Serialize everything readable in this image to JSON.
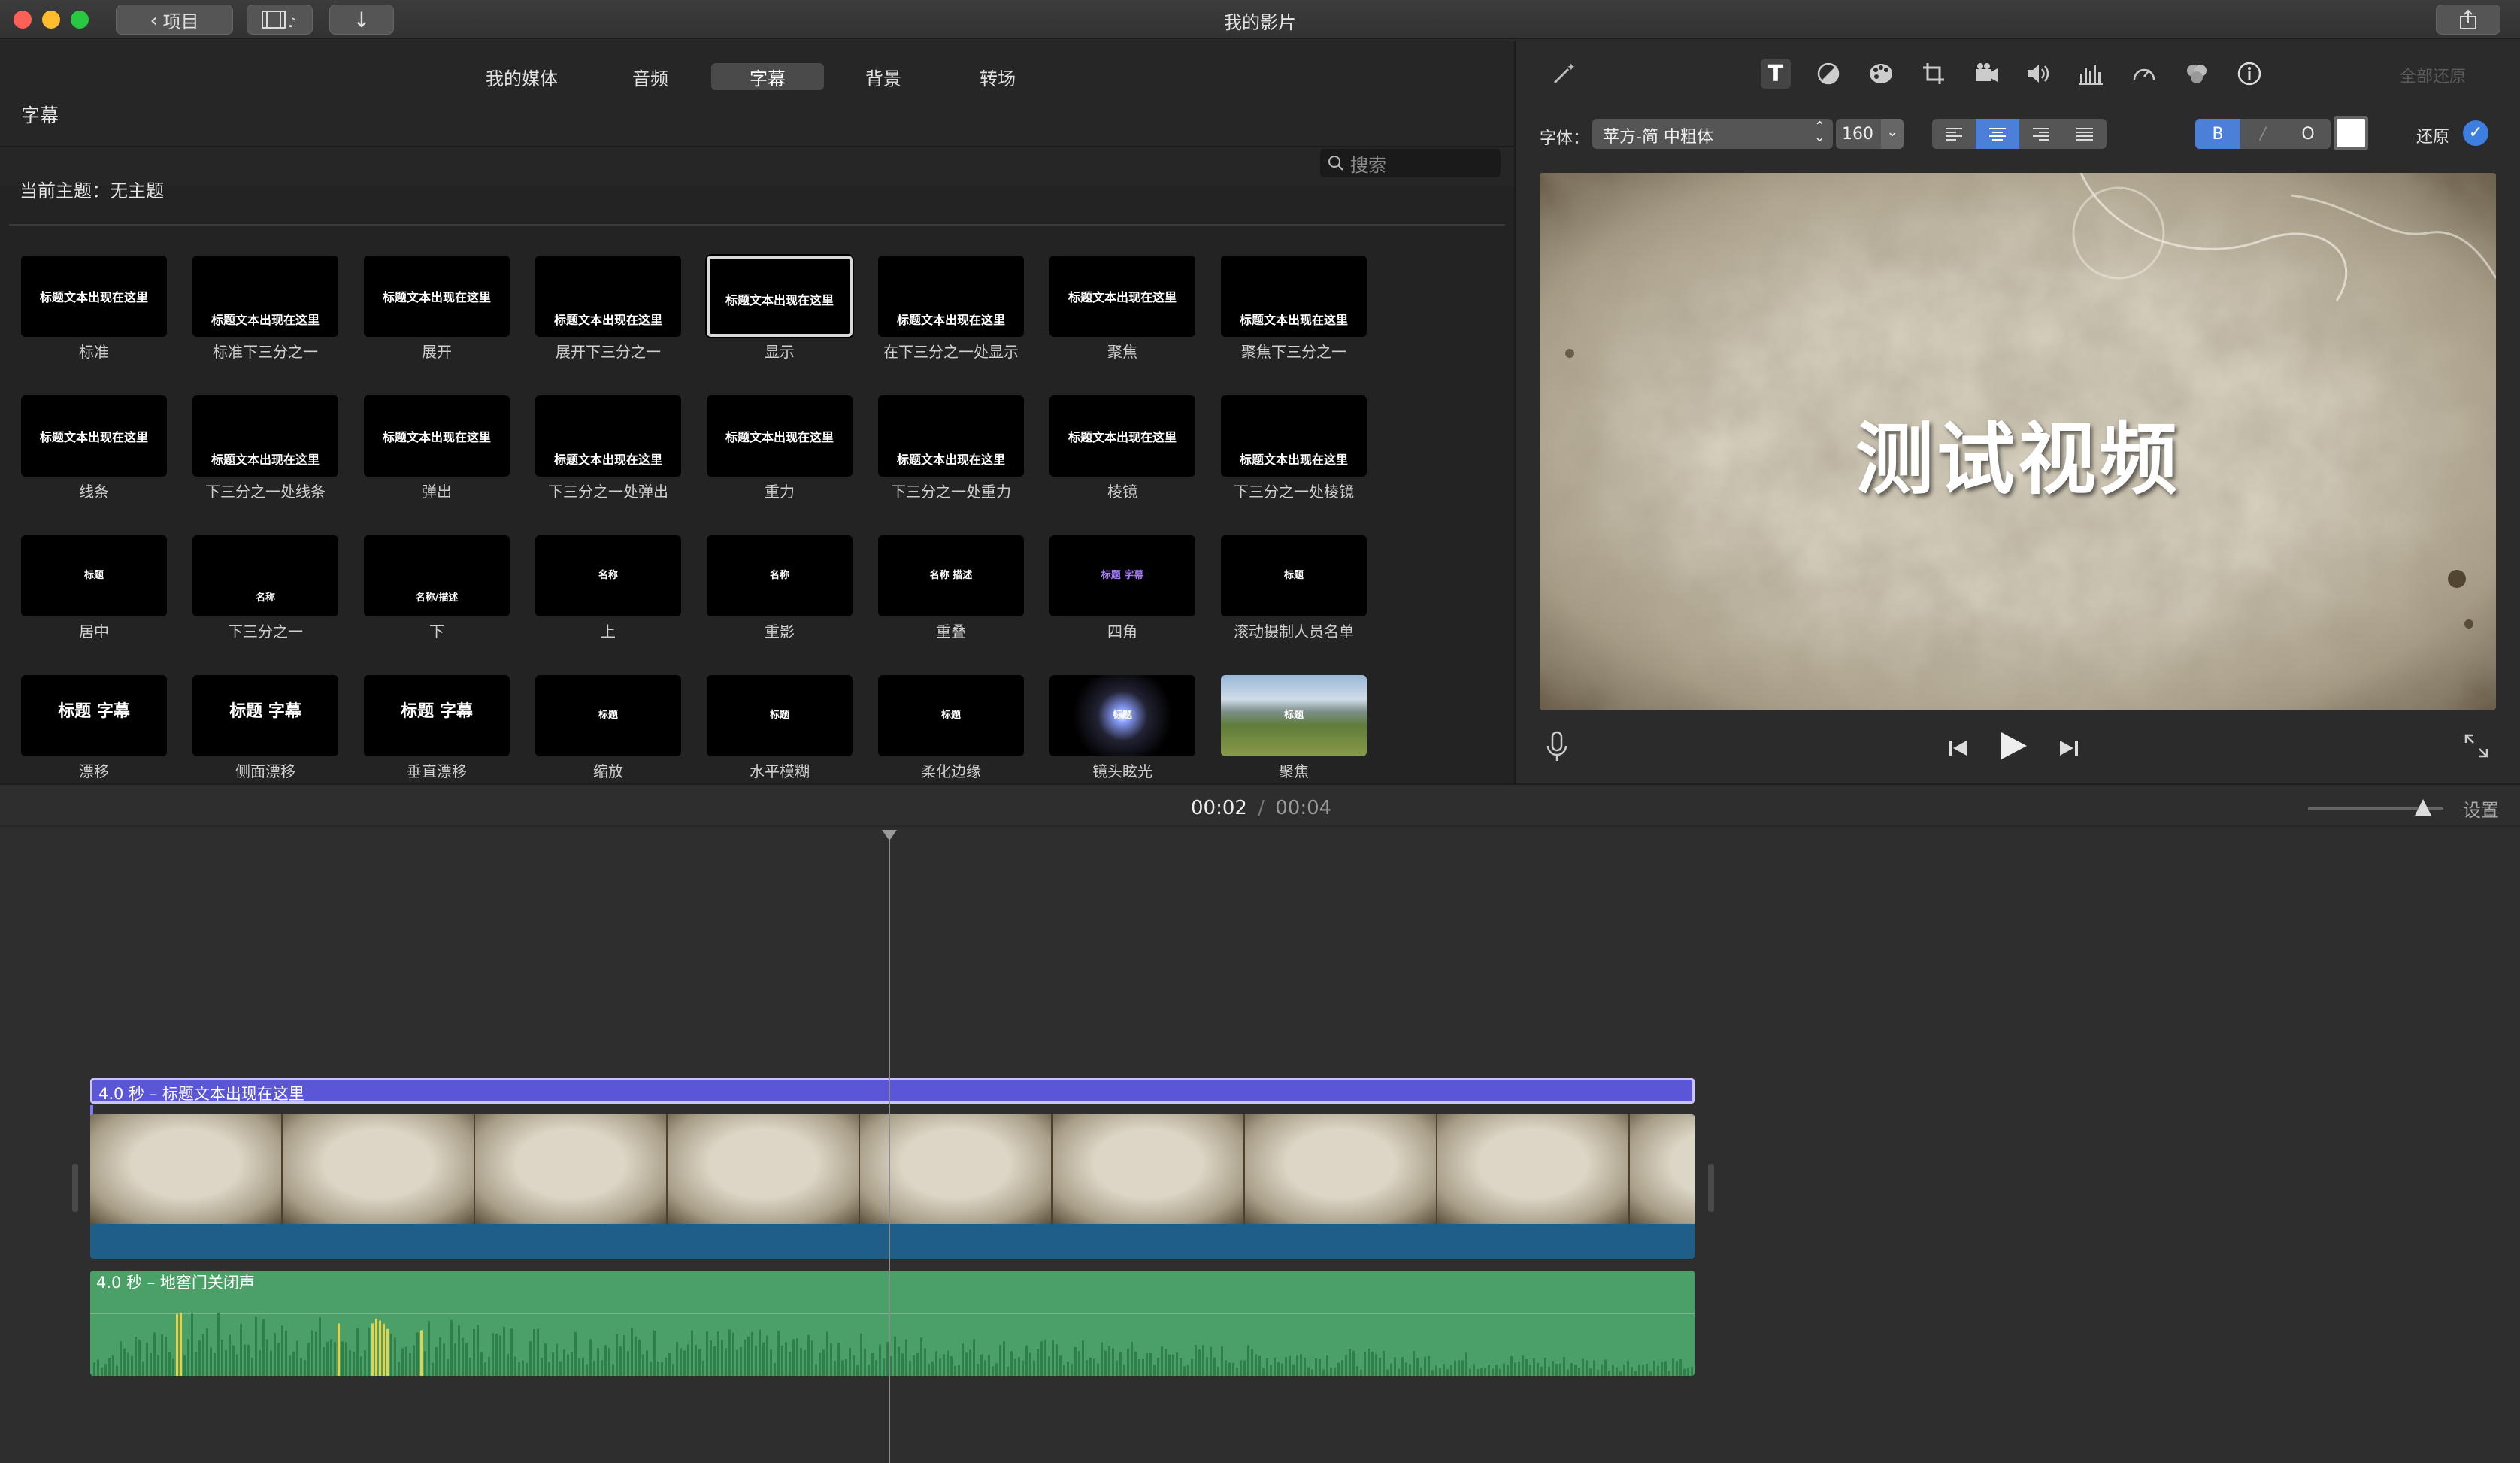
{
  "window": {
    "title": "我的影片",
    "back_label": "项目",
    "share_icon": "share-icon"
  },
  "browser": {
    "tabs": [
      {
        "label": "我的媒体"
      },
      {
        "label": "音频"
      },
      {
        "label": "字幕",
        "active": true
      },
      {
        "label": "背景"
      },
      {
        "label": "转场"
      }
    ],
    "section_title": "字幕",
    "search_placeholder": "搜索",
    "current_theme": "当前主题：无主题",
    "titles": [
      {
        "name": "标准",
        "preview": "标题文本出现在这里"
      },
      {
        "name": "标准下三分之一",
        "preview": "标题文本出现在这里"
      },
      {
        "name": "展开",
        "preview": "标题文本出现在这里"
      },
      {
        "name": "展开下三分之一",
        "preview": "标题文本出现在这里"
      },
      {
        "name": "显示",
        "preview": "标题文本出现在这里",
        "selected": true
      },
      {
        "name": "在下三分之一处显示",
        "preview": "标题文本出现在这里"
      },
      {
        "name": "聚焦",
        "preview": "标题文本出现在这里"
      },
      {
        "name": "聚焦下三分之一",
        "preview": "标题文本出现在这里"
      },
      {
        "name": "线条",
        "preview": "标题文本出现在这里"
      },
      {
        "name": "下三分之一处线条",
        "preview": "标题文本出现在这里"
      },
      {
        "name": "弹出",
        "preview": "标题文本出现在这里"
      },
      {
        "name": "下三分之一处弹出",
        "preview": "标题文本出现在这里"
      },
      {
        "name": "重力",
        "preview": "标题文本出现在这里"
      },
      {
        "name": "下三分之一处重力",
        "preview": "标题文本出现在这里"
      },
      {
        "name": "棱镜",
        "preview": "标题文本出现在这里"
      },
      {
        "name": "下三分之一处棱镜",
        "preview": "标题文本出现在这里"
      },
      {
        "name": "居中",
        "preview": "标题"
      },
      {
        "name": "下三分之一",
        "preview": "名称"
      },
      {
        "name": "下",
        "preview": "名称/描述"
      },
      {
        "name": "上",
        "preview": "名称"
      },
      {
        "name": "重影",
        "preview": "名称"
      },
      {
        "name": "重叠",
        "preview": "名称 描述"
      },
      {
        "name": "四角",
        "preview": "标题 字幕"
      },
      {
        "name": "滚动摄制人员名单",
        "preview": "标题"
      },
      {
        "name": "漂移",
        "preview": "标题 字幕"
      },
      {
        "name": "侧面漂移",
        "preview": "标题 字幕"
      },
      {
        "name": "垂直漂移",
        "preview": "标题 字幕"
      },
      {
        "name": "缩放",
        "preview": "标题"
      },
      {
        "name": "水平模糊",
        "preview": "标题"
      },
      {
        "name": "柔化边缘",
        "preview": "标题"
      },
      {
        "name": "镜头眩光",
        "preview": "标题"
      },
      {
        "name": "聚焦",
        "preview": "标题"
      }
    ]
  },
  "inspector": {
    "reset_all": "全部还原",
    "font_label": "字体：",
    "font_value": "苹方-简 中粗体",
    "font_size": "160",
    "bold_label": "B",
    "outline_label": "O",
    "text_color": "#ffffff",
    "reset_label": "还原",
    "tools": [
      "magic-wand-icon",
      "text-icon",
      "color-balance-icon",
      "palette-icon",
      "crop-icon",
      "video-camera-icon",
      "volume-icon",
      "equalizer-icon",
      "speed-icon",
      "filter-icon",
      "info-icon"
    ]
  },
  "viewer": {
    "title_text": "测试视频"
  },
  "timeline": {
    "current_time": "00:02",
    "separator": "/",
    "total_time": "00:04",
    "settings_label": "设置",
    "zoom_level": 0.85,
    "title_clip_label": "4.0 秒 – 标题文本出现在这里",
    "audio_clip_label": "4.0 秒 – 地窖门关闭声",
    "colors": {
      "title_clip": "#5b55d8",
      "video_audio": "#1f5e86",
      "audio_clip": "#4aa066",
      "audio_peak": "#e5d24a"
    }
  }
}
